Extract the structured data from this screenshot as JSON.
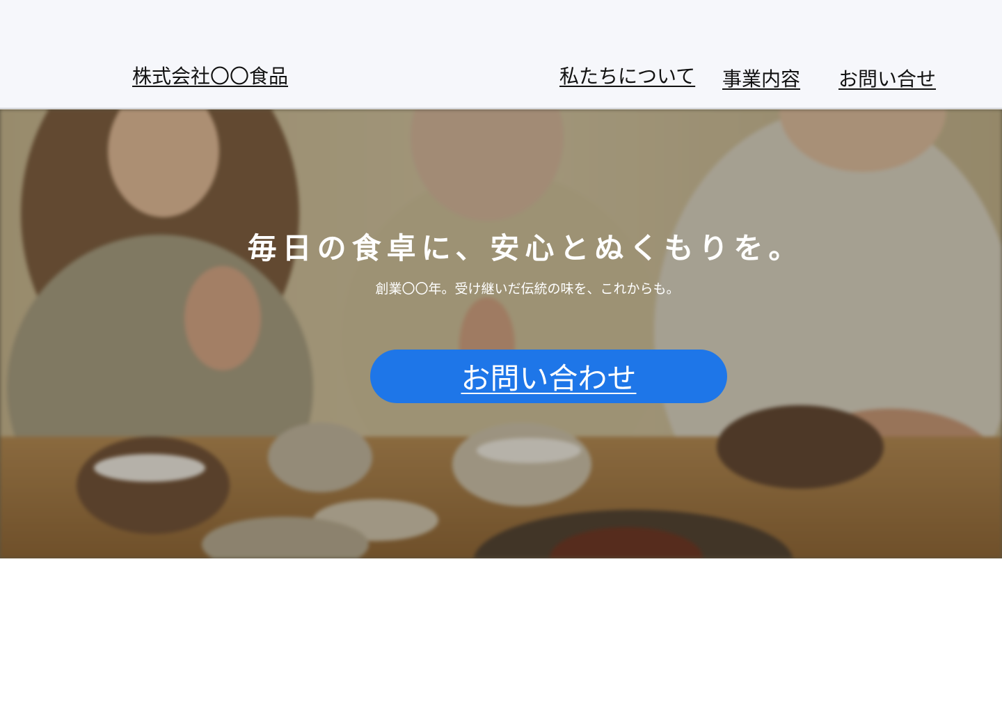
{
  "header": {
    "company_name": "株式会社〇〇食品",
    "nav": {
      "about": "私たちについて",
      "service": "事業内容",
      "contact": "お問い合せ"
    }
  },
  "hero": {
    "image": "family-dinner-photo",
    "title": "毎日の食卓に、安心とぬくもりを。",
    "subtitle": "創業〇〇年。受け継いだ伝統の味を、これからも。",
    "cta_label": "お問い合わせ",
    "cta_color": "#1e76e8"
  },
  "colors": {
    "header_bg": "#f6f7fb",
    "text": "#111111",
    "hero_text": "#ffffff",
    "page_bg": "#ffffff"
  }
}
